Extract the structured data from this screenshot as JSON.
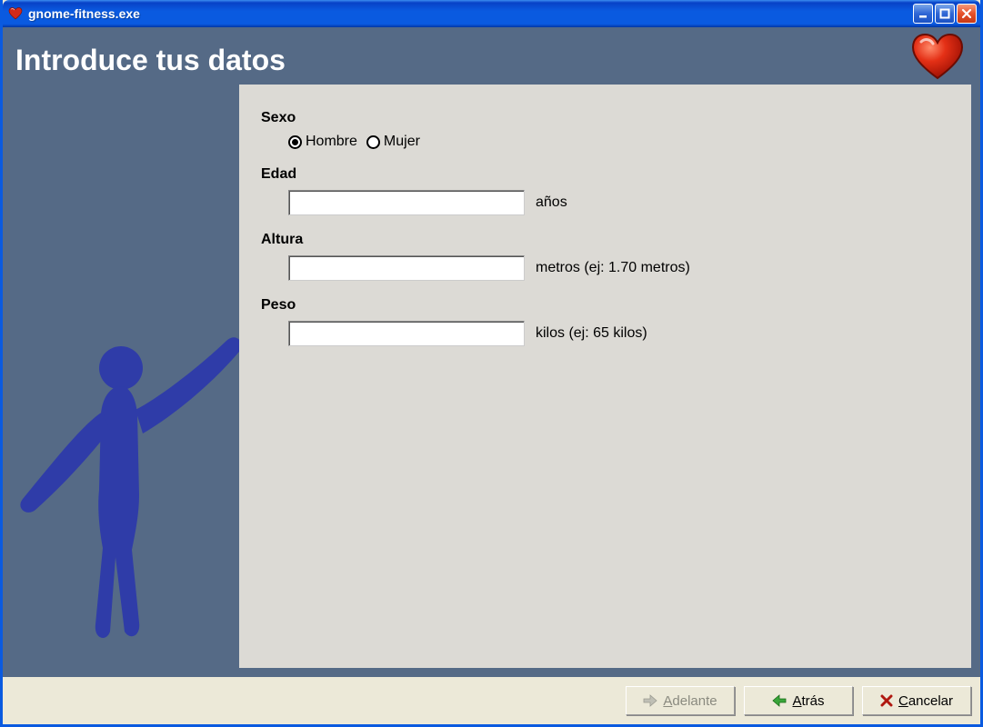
{
  "window": {
    "title": "gnome-fitness.exe"
  },
  "header": {
    "title": "Introduce tus datos"
  },
  "form": {
    "sex": {
      "label": "Sexo",
      "options": {
        "male": "Hombre",
        "female": "Mujer"
      },
      "selected": "male"
    },
    "age": {
      "label": "Edad",
      "value": "",
      "hint": "años"
    },
    "height": {
      "label": "Altura",
      "value": "",
      "hint": "metros (ej: 1.70 metros)"
    },
    "weight": {
      "label": "Peso",
      "value": "",
      "hint": "kilos (ej: 65 kilos)"
    }
  },
  "footer": {
    "forward": "Adelante",
    "back": "Atrás",
    "cancel": "Cancelar"
  },
  "colors": {
    "band": "#556a86",
    "panel": "#dcdad5",
    "chrome": "#ece9d8",
    "dancer": "#2f3ca8"
  }
}
